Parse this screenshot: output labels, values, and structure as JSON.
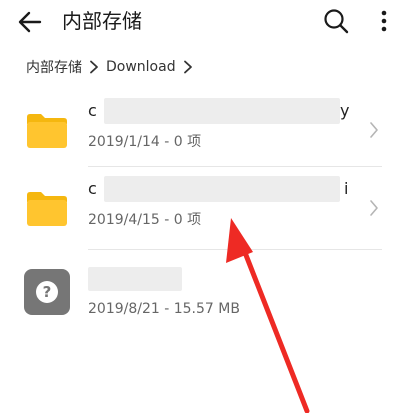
{
  "header": {
    "title": "内部存储",
    "back_icon": "back-arrow-icon",
    "search_icon": "search-icon",
    "more_icon": "more-vertical-icon"
  },
  "breadcrumb": {
    "items": [
      {
        "label": "内部存储"
      },
      {
        "label": "Download"
      }
    ],
    "separator_icon": "chevron-right-icon"
  },
  "files": [
    {
      "type": "folder",
      "icon": "folder-icon",
      "name_start": "c",
      "name_end": "y",
      "meta": "2019/1/14 - 0 项",
      "chevron": true
    },
    {
      "type": "folder",
      "icon": "folder-icon",
      "name_start": "c",
      "name_end": "i",
      "meta": "2019/4/15 - 0 项",
      "chevron": true
    },
    {
      "type": "unknown-file",
      "icon": "unknown-file-icon",
      "icon_glyph": "?",
      "name_start": "",
      "name_end": "",
      "meta": "2019/8/21 - 15.57 MB",
      "chevron": false
    }
  ],
  "colors": {
    "folder": "#FFC52F",
    "folder_tab": "#F5B70F",
    "unknown_icon_bg": "#767676",
    "annotation_arrow": "#EE2A24",
    "redaction": "#EDEDED"
  },
  "annotation": {
    "type": "red-arrow",
    "points_to": "files.1.meta"
  }
}
